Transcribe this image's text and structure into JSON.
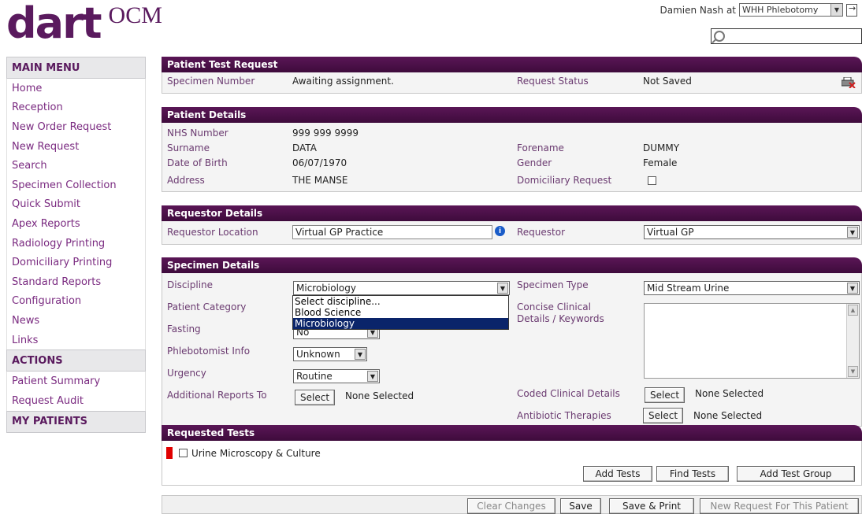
{
  "header": {
    "logo_main": "dart",
    "logo_sub": "OCM",
    "user_text": "Damien Nash at",
    "site_value": "WHH Phlebotomy"
  },
  "sidebar": {
    "main_menu_title": "MAIN MENU",
    "main_items": [
      "Home",
      "Reception",
      "New Order Request",
      "New Request",
      "Search",
      "Specimen Collection",
      "Quick Submit",
      "Apex Reports",
      "Radiology Printing",
      "Domiciliary Printing",
      "Standard Reports",
      "Configuration",
      "News",
      "Links"
    ],
    "actions_title": "ACTIONS",
    "action_items": [
      "Patient Summary",
      "Request Audit"
    ],
    "my_patients_title": "MY PATIENTS"
  },
  "patient_test_request": {
    "title": "Patient Test Request",
    "specimen_number_label": "Specimen Number",
    "specimen_number_value": "Awaiting assignment.",
    "request_status_label": "Request Status",
    "request_status_value": "Not Saved"
  },
  "patient_details": {
    "title": "Patient Details",
    "nhs_label": "NHS Number",
    "nhs_value": "999 999 9999",
    "surname_label": "Surname",
    "surname_value": "DATA",
    "forename_label": "Forename",
    "forename_value": "DUMMY",
    "dob_label": "Date of Birth",
    "dob_value": "06/07/1970",
    "gender_label": "Gender",
    "gender_value": "Female",
    "address_label": "Address",
    "address_value": "THE MANSE",
    "domiciliary_label": "Domiciliary Request",
    "domiciliary_checked": false
  },
  "requestor_details": {
    "title": "Requestor Details",
    "location_label": "Requestor Location",
    "location_value": "Virtual GP Practice",
    "requestor_label": "Requestor",
    "requestor_value": "Virtual GP"
  },
  "specimen_details": {
    "title": "Specimen Details",
    "discipline_label": "Discipline",
    "discipline_value": "Microbiology",
    "discipline_options": [
      "Select discipline...",
      "Blood Science",
      "Microbiology"
    ],
    "patient_category_label": "Patient Category",
    "fasting_label": "Fasting",
    "fasting_value": "No",
    "phlebotomist_label": "Phlebotomist Info",
    "phlebotomist_value": "Unknown",
    "urgency_label": "Urgency",
    "urgency_value": "Routine",
    "additional_reports_label": "Additional Reports To",
    "additional_reports_button": "Select",
    "additional_reports_value": "None Selected",
    "specimen_type_label": "Specimen Type",
    "specimen_type_value": "Mid Stream Urine",
    "concise_clinical_label_1": "Concise Clinical",
    "concise_clinical_label_2": "Details / Keywords",
    "coded_clinical_label": "Coded Clinical Details",
    "coded_clinical_button": "Select",
    "coded_clinical_value": "None Selected",
    "antibiotic_label": "Antibiotic Therapies",
    "antibiotic_button": "Select",
    "antibiotic_value": "None Selected"
  },
  "requested_tests": {
    "title": "Requested Tests",
    "tests": [
      "Urine Microscopy & Culture"
    ],
    "add_tests_button": "Add Tests",
    "find_tests_button": "Find Tests",
    "add_test_group_button": "Add Test Group"
  },
  "footer": {
    "clear_changes": "Clear Changes",
    "save": "Save",
    "save_print": "Save & Print",
    "new_request": "New Request For This Patient"
  },
  "colors": {
    "brand": "#5a1a5e",
    "header_bar": "#4a1048",
    "test_marker": "#e00000"
  }
}
